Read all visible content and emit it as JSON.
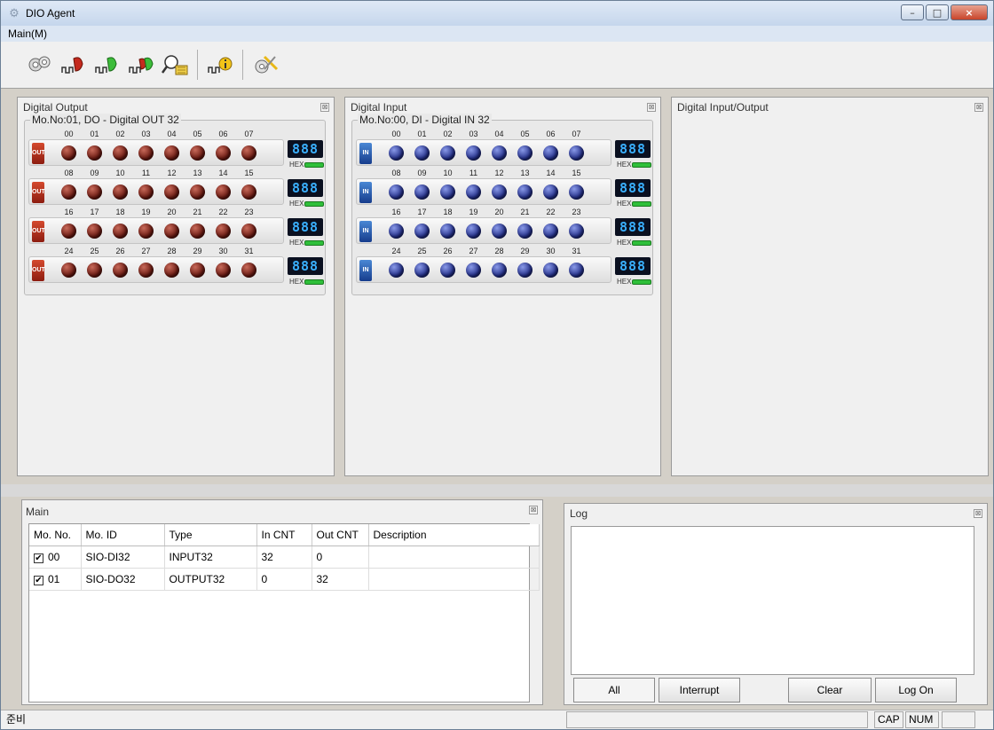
{
  "window": {
    "title": "DIO Agent",
    "minimize": "–",
    "maximize": "□",
    "close": "×"
  },
  "menu": {
    "main": "Main(M)"
  },
  "toolbar": {
    "icons": [
      "device-scan-icon",
      "digital-output-icon",
      "digital-input-icon",
      "digital-io-icon",
      "counter-search-icon",
      "module-info-icon",
      "settings-tools-icon"
    ]
  },
  "panes": {
    "digital_output": {
      "title": "Digital Output",
      "group": "Mo.No:01, DO - Digital OUT 32",
      "tag": "OUT"
    },
    "digital_input": {
      "title": "Digital Input",
      "group": "Mo.No:00, DI - Digital IN 32",
      "tag": "IN"
    },
    "digital_io": {
      "title": "Digital Input/Output"
    },
    "close_glyph": "⊠"
  },
  "rows": [
    {
      "nums": [
        "00",
        "01",
        "02",
        "03",
        "04",
        "05",
        "06",
        "07"
      ]
    },
    {
      "nums": [
        "08",
        "09",
        "10",
        "11",
        "12",
        "13",
        "14",
        "15"
      ]
    },
    {
      "nums": [
        "16",
        "17",
        "18",
        "19",
        "20",
        "21",
        "22",
        "23"
      ]
    },
    {
      "nums": [
        "24",
        "25",
        "26",
        "27",
        "28",
        "29",
        "30",
        "31"
      ]
    }
  ],
  "seg_display": "888",
  "hex_label": "HEX",
  "main": {
    "title": "Main",
    "columns": [
      "Mo. No.",
      "Mo. ID",
      "Type",
      "In CNT",
      "Out CNT",
      "Description"
    ],
    "modules": [
      {
        "checked": "✔",
        "no": "00",
        "id": "SIO-DI32",
        "type": "INPUT32",
        "in": "32",
        "out": "0",
        "desc": ""
      },
      {
        "checked": "✔",
        "no": "01",
        "id": "SIO-DO32",
        "type": "OUTPUT32",
        "in": "0",
        "out": "32",
        "desc": ""
      }
    ]
  },
  "log": {
    "title": "Log",
    "buttons": {
      "all": "All",
      "interrupt": "Interrupt",
      "clear": "Clear",
      "logon": "Log On"
    }
  },
  "status": {
    "ready": "준비",
    "cap": "CAP",
    "num": "NUM"
  },
  "colors": {
    "led_out": "#6a1a12",
    "led_in": "#24308a",
    "seg": "#3ab0ff",
    "hex_bar": "#2fbf3a"
  }
}
